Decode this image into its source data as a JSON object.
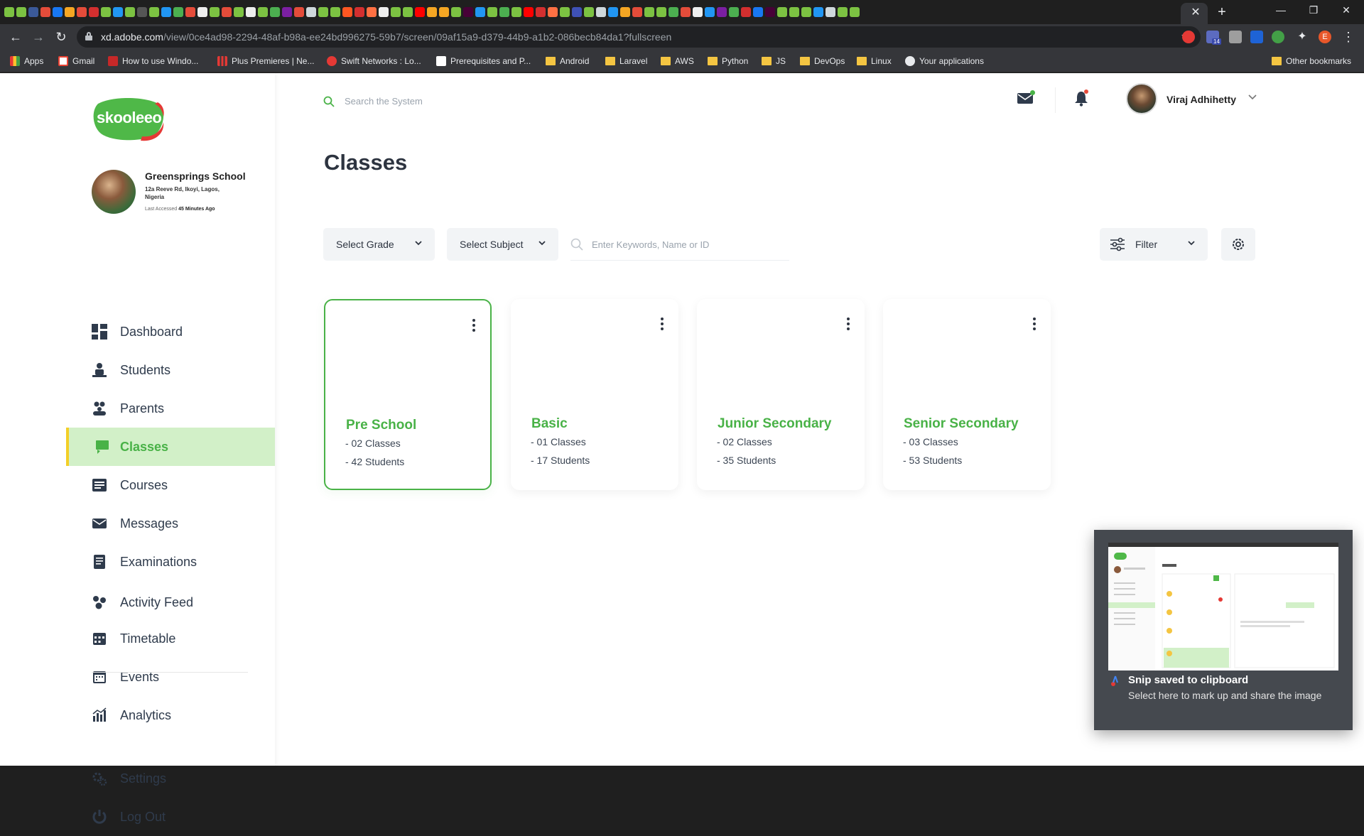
{
  "browser": {
    "url_host": "xd.adobe.com",
    "url_path": "/view/0ce4ad98-2294-48af-b98a-ee24bd996275-59b7/screen/09af15a9-d379-44b9-a1b2-086becb84da1?fullscreen",
    "profile_initial": "E",
    "extension_badge": "14",
    "bookmarks": [
      {
        "label": "Apps",
        "icon": "apps-grid-icon"
      },
      {
        "label": "Gmail",
        "icon": "gmail-icon"
      },
      {
        "label": "How to use Windo...",
        "icon": "site-icon"
      },
      {
        "label": "Plus Premieres | Ne...",
        "icon": "chart-bars-icon"
      },
      {
        "label": "Swift Networks : Lo...",
        "icon": "swift-icon"
      },
      {
        "label": "Prerequisites and P...",
        "icon": "site-icon"
      },
      {
        "label": "Android",
        "icon": "folder-icon"
      },
      {
        "label": "Laravel",
        "icon": "folder-icon"
      },
      {
        "label": "AWS",
        "icon": "folder-icon"
      },
      {
        "label": "Python",
        "icon": "folder-icon"
      },
      {
        "label": "JS",
        "icon": "folder-icon"
      },
      {
        "label": "DevOps",
        "icon": "folder-icon"
      },
      {
        "label": "Linux",
        "icon": "folder-icon"
      },
      {
        "label": "Your applications",
        "icon": "github-icon"
      }
    ],
    "other_bookmarks": "Other bookmarks"
  },
  "app": {
    "logo_text": "skooleeo",
    "school": {
      "name": "Greensprings School",
      "address": "12a Reeve Rd, Ikoyi, Lagos, Nigeria",
      "last_accessed_label": "Last Accessed",
      "last_accessed_value": "45 Minutes Ago"
    },
    "nav": [
      {
        "label": "Dashboard",
        "icon": "dashboard-icon",
        "active": false
      },
      {
        "label": "Students",
        "icon": "students-icon",
        "active": false
      },
      {
        "label": "Parents",
        "icon": "parents-icon",
        "active": false
      },
      {
        "label": "Classes",
        "icon": "classes-icon",
        "active": true
      },
      {
        "label": "Courses",
        "icon": "courses-icon",
        "active": false
      },
      {
        "label": "Messages",
        "icon": "messages-icon",
        "active": false
      },
      {
        "label": "Examinations",
        "icon": "examinations-icon",
        "active": false
      },
      {
        "label": "Activity Feed",
        "icon": "activity-feed-icon",
        "active": false
      },
      {
        "label": "Timetable",
        "icon": "timetable-icon",
        "active": false
      },
      {
        "label": "Events",
        "icon": "events-icon",
        "active": false
      },
      {
        "label": "Analytics",
        "icon": "analytics-icon",
        "active": false
      }
    ],
    "bottom_nav": [
      {
        "label": "Settings",
        "icon": "settings-gear-icon"
      },
      {
        "label": "Log Out",
        "icon": "logout-power-icon"
      }
    ],
    "search_placeholder": "Search the System",
    "user_name": "Viraj Adhihetty",
    "page_title": "Classes",
    "filters": {
      "grade": "Select Grade",
      "subject": "Select Subject",
      "keyword_placeholder": "Enter Keywords, Name or ID",
      "filter_label": "Filter"
    },
    "cards": [
      {
        "title": "Pre School",
        "classes": "- 02 Classes",
        "students": "- 42 Students",
        "selected": true
      },
      {
        "title": "Basic",
        "classes": "- 01 Classes",
        "students": "- 17 Students",
        "selected": false
      },
      {
        "title": "Junior Secondary",
        "classes": "- 02 Classes",
        "students": "- 35 Students",
        "selected": false
      },
      {
        "title": "Senior Secondary",
        "classes": "- 03 Classes",
        "students": "- 53 Students",
        "selected": false
      }
    ],
    "colors": {
      "brand_green": "#49b247",
      "active_bg": "#d2f0c8",
      "active_border": "#f3cf27",
      "text_dark": "#2d3440"
    }
  },
  "toast": {
    "title": "Snip saved to clipboard",
    "body": "Select here to mark up and share the image"
  }
}
